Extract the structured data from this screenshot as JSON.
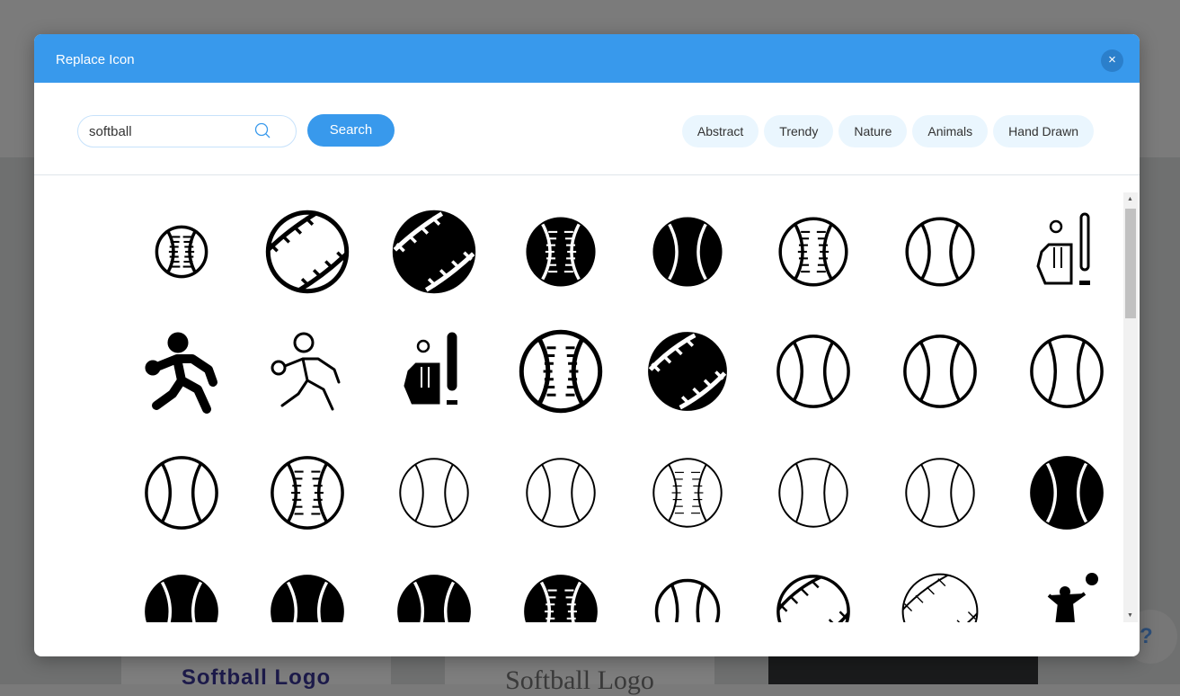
{
  "background": {
    "card1": "Softball Logo",
    "card2": "Softball Logo",
    "help": "?"
  },
  "modal": {
    "title": "Replace Icon",
    "close": "×",
    "search": {
      "value": "softball",
      "button": "Search"
    },
    "tags": [
      "Abstract",
      "Trendy",
      "Nature",
      "Animals",
      "Hand Drawn"
    ],
    "accent": "#3899ec",
    "icons": [
      {
        "name": "baseball-small-outline-icon",
        "kind": "ball",
        "fill": false,
        "stitch": true,
        "size": 0.6
      },
      {
        "name": "softball-diagonal-bold-icon",
        "kind": "diag",
        "fill": false,
        "stitch": true,
        "size": 0.95
      },
      {
        "name": "softball-diagonal-filled-icon",
        "kind": "diag",
        "fill": true,
        "stitch": true,
        "size": 0.95
      },
      {
        "name": "baseball-filled-icon",
        "kind": "ball",
        "fill": true,
        "stitch": true,
        "size": 0.8
      },
      {
        "name": "ball-filled-icon",
        "kind": "ball",
        "fill": true,
        "stitch": false,
        "size": 0.8
      },
      {
        "name": "baseball-outline-icon",
        "kind": "ball",
        "fill": false,
        "stitch": true,
        "size": 0.8
      },
      {
        "name": "ball-outline-icon",
        "kind": "ball",
        "fill": false,
        "stitch": false,
        "size": 0.8
      },
      {
        "name": "glove-bat-outline-icon",
        "kind": "glove",
        "fill": false
      },
      {
        "name": "pitcher-filled-icon",
        "kind": "player",
        "fill": true
      },
      {
        "name": "pitcher-outline-icon",
        "kind": "player",
        "fill": false
      },
      {
        "name": "glove-bat-filled-icon",
        "kind": "glove",
        "fill": true
      },
      {
        "name": "baseball-outline-icon",
        "kind": "ball",
        "fill": false,
        "stitch": true,
        "size": 0.95
      },
      {
        "name": "softball-diagonal-filled-icon",
        "kind": "diag",
        "fill": true,
        "stitch": true,
        "size": 0.9
      },
      {
        "name": "ball-outline-icon",
        "kind": "ball",
        "fill": false,
        "stitch": false,
        "size": 0.85
      },
      {
        "name": "ball-outline-icon",
        "kind": "ball",
        "fill": false,
        "stitch": false,
        "size": 0.85
      },
      {
        "name": "tennis-ball-outline-icon",
        "kind": "tennis",
        "fill": false,
        "size": 0.85
      },
      {
        "name": "ball-outline-icon",
        "kind": "ball",
        "fill": false,
        "stitch": false,
        "size": 0.85
      },
      {
        "name": "baseball-outline-icon",
        "kind": "ball",
        "fill": false,
        "stitch": true,
        "size": 0.85
      },
      {
        "name": "ball-thin-outline-icon",
        "kind": "ball",
        "fill": false,
        "stitch": false,
        "size": 0.82,
        "thin": true
      },
      {
        "name": "ball-thin-outline-icon",
        "kind": "ball",
        "fill": false,
        "stitch": false,
        "size": 0.82,
        "thin": true
      },
      {
        "name": "baseball-thin-outline-icon",
        "kind": "ball",
        "fill": false,
        "stitch": true,
        "size": 0.82,
        "thin": true
      },
      {
        "name": "tennis-ball-thin-outline-icon",
        "kind": "tennis",
        "fill": false,
        "size": 0.82,
        "thin": true
      },
      {
        "name": "ball-thin-outline-icon",
        "kind": "ball",
        "fill": false,
        "stitch": false,
        "size": 0.82,
        "thin": true
      },
      {
        "name": "ball-filled-icon",
        "kind": "ball",
        "fill": true,
        "stitch": false,
        "size": 0.85
      },
      {
        "name": "ball-filled-icon",
        "kind": "ball",
        "fill": true,
        "stitch": false,
        "size": 0.85
      },
      {
        "name": "ball-filled-icon",
        "kind": "ball",
        "fill": true,
        "stitch": false,
        "size": 0.85
      },
      {
        "name": "ball-filled-icon",
        "kind": "ball",
        "fill": true,
        "stitch": false,
        "size": 0.85
      },
      {
        "name": "baseball-filled-icon",
        "kind": "ball",
        "fill": true,
        "stitch": true,
        "size": 0.85
      },
      {
        "name": "tennis-ball-outline-icon",
        "kind": "tennis",
        "fill": false,
        "size": 0.75
      },
      {
        "name": "softball-diagonal-outline-icon",
        "kind": "diag",
        "fill": false,
        "stitch": true,
        "size": 0.85
      },
      {
        "name": "softball-diagonal-thin-icon",
        "kind": "diag",
        "fill": false,
        "stitch": true,
        "size": 0.9,
        "thin": true
      },
      {
        "name": "players-catch-icon",
        "kind": "players",
        "fill": true
      }
    ]
  }
}
